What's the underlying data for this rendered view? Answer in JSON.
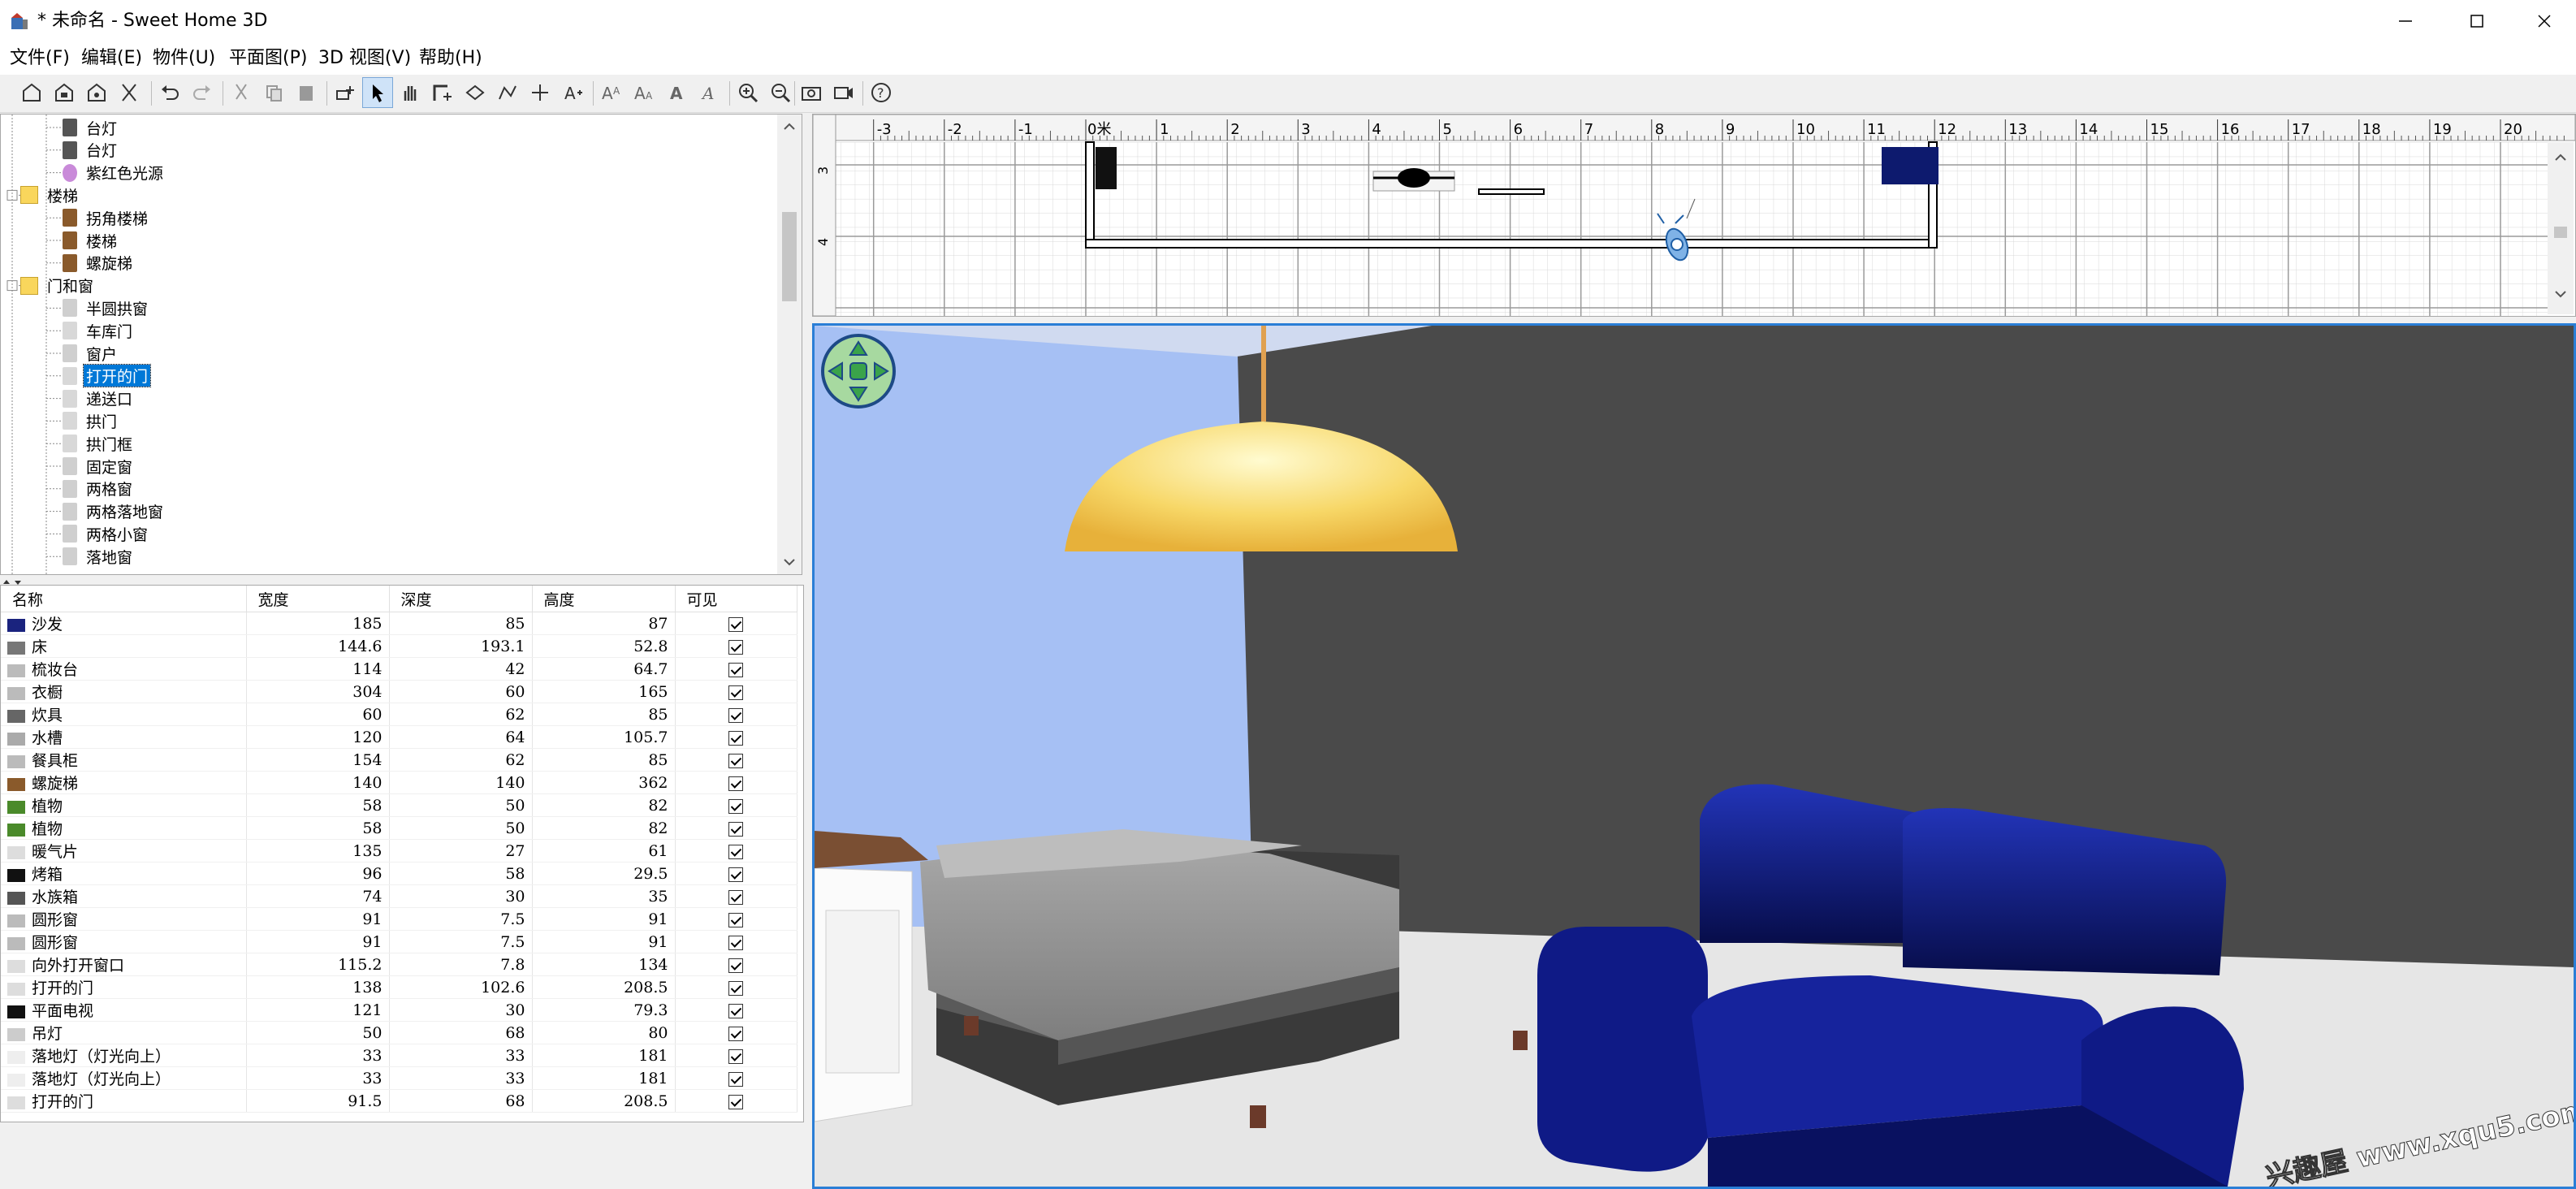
{
  "window": {
    "title": "* 未命名 - Sweet Home 3D",
    "controls": [
      "minimize",
      "maximize",
      "close"
    ]
  },
  "menubar": [
    "文件(F)",
    "编辑(E)",
    "物件(U)",
    "平面图(P)",
    "3D 视图(V)",
    "帮助(H)"
  ],
  "toolbar": {
    "icons": [
      "new-home",
      "open",
      "save",
      "cut-tool",
      "undo",
      "redo",
      "cut",
      "copy",
      "paste",
      "add-furniture",
      "select-mode",
      "pan-mode",
      "create-walls",
      "create-rooms",
      "create-polylines",
      "create-dimensions",
      "add-text",
      "increase-text",
      "decrease-text",
      "bold-text",
      "italic-text",
      "zoom-in",
      "zoom-out",
      "create-photo",
      "create-video",
      "help"
    ],
    "active": "select-mode"
  },
  "catalog": {
    "items": [
      {
        "label": "台灯",
        "level": 2,
        "icon": "lamp"
      },
      {
        "label": "台灯",
        "level": 2,
        "icon": "lamp"
      },
      {
        "label": "紫红色光源",
        "level": 2,
        "icon": "light"
      },
      {
        "label": "楼梯",
        "level": 1,
        "icon": "folder",
        "expanded": true
      },
      {
        "label": "拐角楼梯",
        "level": 2,
        "icon": "stair"
      },
      {
        "label": "楼梯",
        "level": 2,
        "icon": "stair"
      },
      {
        "label": "螺旋梯",
        "level": 2,
        "icon": "spiral"
      },
      {
        "label": "门和窗",
        "level": 1,
        "icon": "folder",
        "expanded": true
      },
      {
        "label": "半圆拱窗",
        "level": 2,
        "icon": "window"
      },
      {
        "label": "车库门",
        "level": 2,
        "icon": "door"
      },
      {
        "label": "窗户",
        "level": 2,
        "icon": "window"
      },
      {
        "label": "打开的门",
        "level": 2,
        "icon": "door",
        "selected": true
      },
      {
        "label": "递送口",
        "level": 2,
        "icon": "door"
      },
      {
        "label": "拱门",
        "level": 2,
        "icon": "door"
      },
      {
        "label": "拱门框",
        "level": 2,
        "icon": "door"
      },
      {
        "label": "固定窗",
        "level": 2,
        "icon": "window"
      },
      {
        "label": "两格窗",
        "level": 2,
        "icon": "window"
      },
      {
        "label": "两格落地窗",
        "level": 2,
        "icon": "window"
      },
      {
        "label": "两格小窗",
        "level": 2,
        "icon": "window"
      },
      {
        "label": "落地窗",
        "level": 2,
        "icon": "window"
      }
    ]
  },
  "furniture": {
    "columns": [
      "名称",
      "宽度",
      "深度",
      "高度",
      "可见"
    ],
    "rows": [
      {
        "name": "沙发",
        "w": "185",
        "d": "85",
        "h": "87",
        "icon": "sofa"
      },
      {
        "name": "床",
        "w": "144.6",
        "d": "193.1",
        "h": "52.8",
        "icon": "bed"
      },
      {
        "name": "梳妆台",
        "w": "114",
        "d": "42",
        "h": "64.7",
        "icon": "dresser"
      },
      {
        "name": "衣橱",
        "w": "304",
        "d": "60",
        "h": "165",
        "icon": "wardrobe"
      },
      {
        "name": "炊具",
        "w": "60",
        "d": "62",
        "h": "85",
        "icon": "cooker"
      },
      {
        "name": "水槽",
        "w": "120",
        "d": "64",
        "h": "105.7",
        "icon": "sink"
      },
      {
        "name": "餐具柜",
        "w": "154",
        "d": "62",
        "h": "85",
        "icon": "cabinet"
      },
      {
        "name": "螺旋梯",
        "w": "140",
        "d": "140",
        "h": "362",
        "icon": "spiral"
      },
      {
        "name": "植物",
        "w": "58",
        "d": "50",
        "h": "82",
        "icon": "plant"
      },
      {
        "name": "植物",
        "w": "58",
        "d": "50",
        "h": "82",
        "icon": "plant"
      },
      {
        "name": "暖气片",
        "w": "135",
        "d": "27",
        "h": "61",
        "icon": "radiator"
      },
      {
        "name": "烤箱",
        "w": "96",
        "d": "58",
        "h": "29.5",
        "icon": "oven"
      },
      {
        "name": "水族箱",
        "w": "74",
        "d": "30",
        "h": "35",
        "icon": "aquarium"
      },
      {
        "name": "圆形窗",
        "w": "91",
        "d": "7.5",
        "h": "91",
        "icon": "round-window"
      },
      {
        "name": "圆形窗",
        "w": "91",
        "d": "7.5",
        "h": "91",
        "icon": "round-window"
      },
      {
        "name": "向外打开窗口",
        "w": "115.2",
        "d": "7.8",
        "h": "134",
        "icon": "window"
      },
      {
        "name": "打开的门",
        "w": "138",
        "d": "102.6",
        "h": "208.5",
        "icon": "door"
      },
      {
        "name": "平面电视",
        "w": "121",
        "d": "30",
        "h": "79.3",
        "icon": "tv"
      },
      {
        "name": "吊灯",
        "w": "50",
        "d": "68",
        "h": "80",
        "icon": "pendant"
      },
      {
        "name": "落地灯（灯光向上）",
        "w": "33",
        "d": "33",
        "h": "181",
        "icon": "floor-lamp"
      },
      {
        "name": "落地灯（灯光向上）",
        "w": "33",
        "d": "33",
        "h": "181",
        "icon": "floor-lamp"
      },
      {
        "name": "打开的门",
        "w": "91.5",
        "d": "68",
        "h": "208.5",
        "icon": "door"
      }
    ]
  },
  "plan": {
    "ruler_unit_label": "0米",
    "ruler_values": [
      "-3",
      "-2",
      "-1",
      "1",
      "2",
      "3",
      "4",
      "5",
      "6",
      "7",
      "8",
      "9",
      "10",
      "11",
      "12",
      "13",
      "14",
      "15",
      "16",
      "17",
      "18",
      "19",
      "20"
    ],
    "vertical_ruler": [
      "3",
      "4"
    ]
  },
  "view3d": {
    "navigator": "navigation-arrows",
    "watermark": "兴趣屋 www.xqu5.com"
  },
  "colors": {
    "accent": "#0078d7",
    "sofa": "#0d1a7a",
    "wall": "#4a4a4a",
    "wall_left": "#a8c1f3",
    "floor": "#e6e6e6",
    "lamp": "#f5c84a",
    "selection": "#2a7ed6"
  }
}
